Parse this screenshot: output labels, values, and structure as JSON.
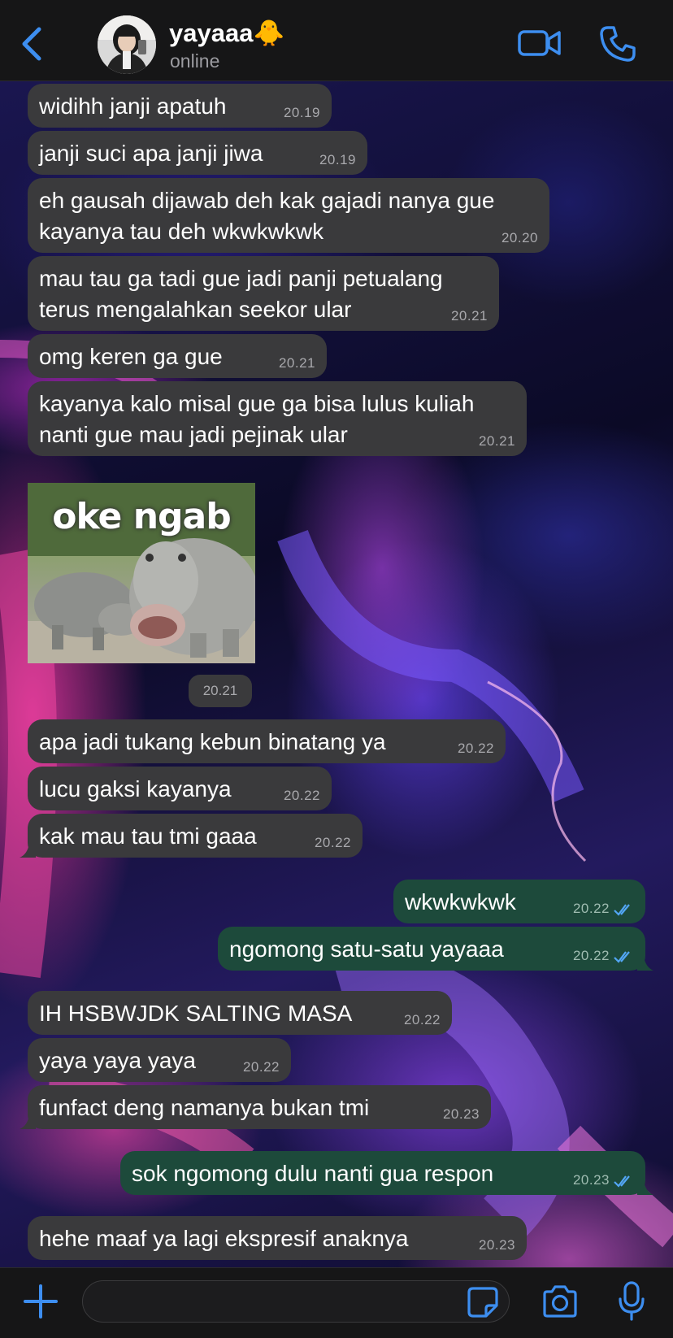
{
  "header": {
    "contact_name": "yayaaa🐥",
    "status": "online"
  },
  "colors": {
    "accent": "#3d8ef0",
    "incoming_bubble": "#3a3a3c",
    "outgoing_bubble": "#1d4a3b",
    "read_ticks": "#53a6f5"
  },
  "icons": {
    "back": "chevron-left-icon",
    "video": "video-camera-icon",
    "call": "phone-icon",
    "add": "plus-icon",
    "sticker": "sticker-icon",
    "camera": "camera-icon",
    "mic": "microphone-icon"
  },
  "messages": [
    {
      "direction": "in",
      "lines": [
        "widihh janji apatuh"
      ],
      "time": "20.19"
    },
    {
      "direction": "in",
      "lines": [
        "janji suci apa janji jiwa"
      ],
      "time": "20.19"
    },
    {
      "direction": "in",
      "lines": [
        "eh gausah dijawab deh kak gajadi nanya gue",
        "kayanya tau deh wkwkwkwk"
      ],
      "time": "20.20"
    },
    {
      "direction": "in",
      "lines": [
        "mau tau ga tadi gue jadi panji petualang",
        "terus mengalahkan seekor ular"
      ],
      "time": "20.21"
    },
    {
      "direction": "in",
      "lines": [
        "omg keren ga gue"
      ],
      "time": "20.21"
    },
    {
      "direction": "in",
      "lines": [
        "kayanya kalo misal gue ga bisa lulus kuliah",
        "nanti gue mau jadi pejinak ular"
      ],
      "time": "20.21"
    },
    {
      "direction": "in",
      "type": "sticker",
      "caption": "oke ngab",
      "time": "20.21"
    },
    {
      "direction": "in",
      "lines": [
        "apa jadi tukang kebun binatang ya"
      ],
      "time": "20.22"
    },
    {
      "direction": "in",
      "lines": [
        "lucu gaksi kayanya"
      ],
      "time": "20.22"
    },
    {
      "direction": "in",
      "lines": [
        "kak mau tau tmi gaaa"
      ],
      "time": "20.22"
    },
    {
      "direction": "out",
      "lines": [
        "wkwkwkwk"
      ],
      "time": "20.22",
      "read": true
    },
    {
      "direction": "out",
      "lines": [
        "ngomong satu-satu yayaaa"
      ],
      "time": "20.22",
      "read": true
    },
    {
      "direction": "in",
      "lines": [
        "IH HSBWJDK SALTING MASA"
      ],
      "time": "20.22"
    },
    {
      "direction": "in",
      "lines": [
        "yaya yaya yaya"
      ],
      "time": "20.22"
    },
    {
      "direction": "in",
      "lines": [
        "funfact deng namanya bukan tmi"
      ],
      "time": "20.23"
    },
    {
      "direction": "out",
      "lines": [
        "sok ngomong dulu nanti gua respon"
      ],
      "time": "20.23",
      "read": true
    },
    {
      "direction": "in",
      "lines": [
        "hehe maaf ya lagi ekspresif anaknya"
      ],
      "time": "20.23"
    }
  ],
  "composer": {
    "input_value": "",
    "input_placeholder": ""
  }
}
